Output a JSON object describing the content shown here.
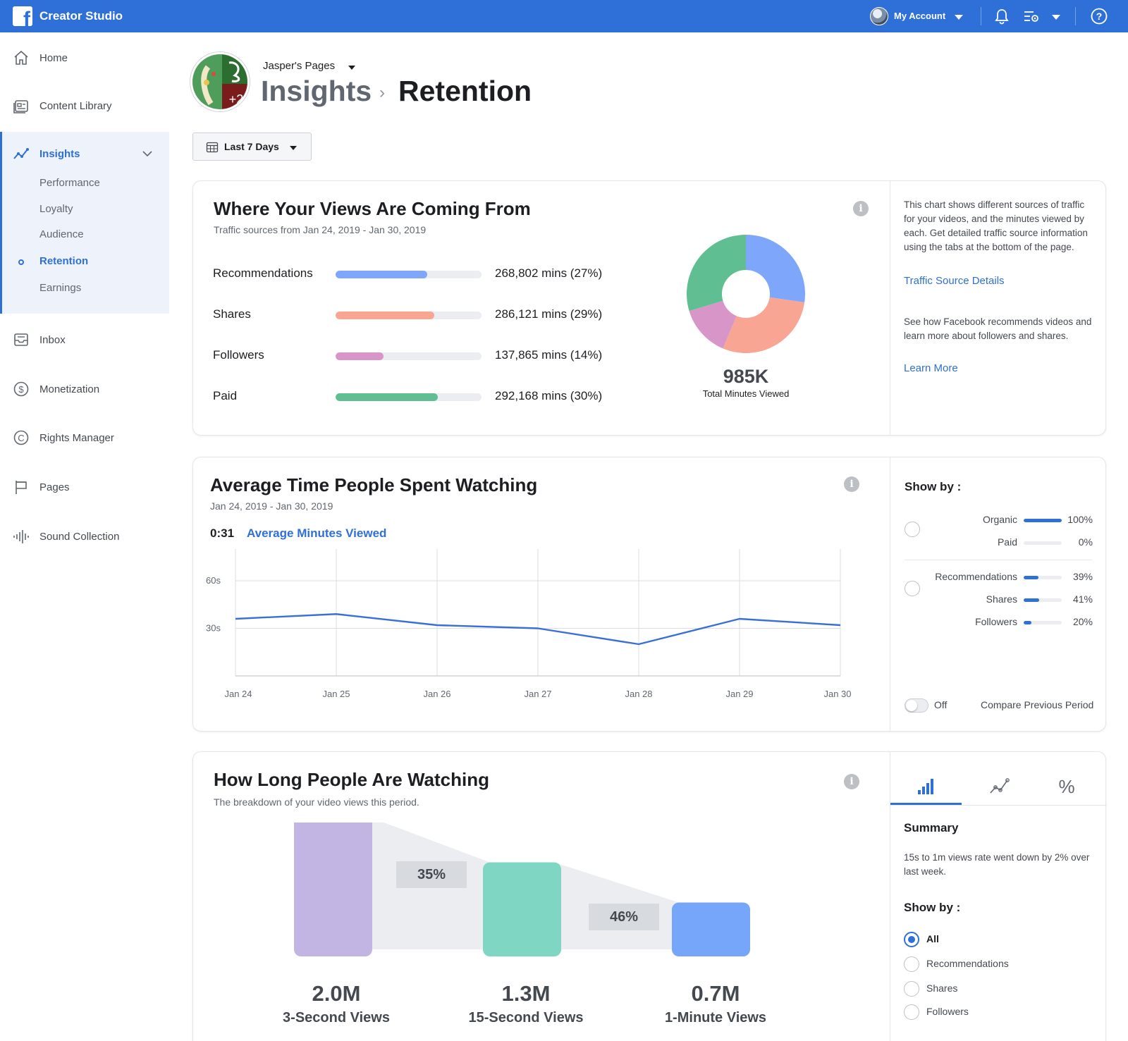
{
  "topbar": {
    "app_title": "Creator Studio",
    "account_label": "My Account",
    "icons": [
      "bell-icon",
      "settings-icon",
      "help-icon"
    ]
  },
  "sidebar": {
    "items": [
      {
        "label": "Home",
        "icon": "home-icon"
      },
      {
        "label": "Content Library",
        "icon": "content-library-icon"
      },
      {
        "label": "Insights",
        "icon": "insights-icon"
      },
      {
        "label": "Inbox",
        "icon": "inbox-icon"
      },
      {
        "label": "Monetization",
        "icon": "dollar-icon"
      },
      {
        "label": "Rights Manager",
        "icon": "copyright-icon"
      },
      {
        "label": "Pages",
        "icon": "flag-icon"
      },
      {
        "label": "Sound Collection",
        "icon": "sound-wave-icon"
      }
    ],
    "insights_sub": [
      "Performance",
      "Loyalty",
      "Audience",
      "Retention",
      "Earnings"
    ],
    "active_sub": "Retention"
  },
  "header": {
    "page_name": "Jasper's Pages",
    "crumb_parent": "Insights",
    "crumb_current": "Retention",
    "date_range_label": "Last 7 Days"
  },
  "views_card": {
    "title": "Where Your Views Are Coming From",
    "subtitle": "Traffic sources from Jan 24, 2019 - Jan 30, 2019",
    "sources": [
      {
        "label": "Recommendations",
        "value": "268,802 mins (27%)",
        "pct": 27,
        "color": "#7ea7fb"
      },
      {
        "label": "Shares",
        "value": "286,121 mins (29%)",
        "pct": 29,
        "color": "#f8a594"
      },
      {
        "label": "Followers",
        "value": "137,865 mins (14%)",
        "pct": 14,
        "color": "#d896c8"
      },
      {
        "label": "Paid",
        "value": "292,168 mins (30%)",
        "pct": 30,
        "color": "#5fbf93"
      }
    ],
    "total_value": "985K",
    "total_label": "Total Minutes Viewed",
    "side_text_1": "This chart shows different sources of traffic for your videos, and the minutes viewed by each. Get detailed traffic source information using the tabs at the bottom of the page.",
    "side_link_1": "Traffic Source Details",
    "side_text_2": "See how Facebook recommends videos and learn more about followers and shares.",
    "side_link_2": "Learn More"
  },
  "avg_card": {
    "title": "Average Time People Spent Watching",
    "subtitle": "Jan 24, 2019 - Jan 30, 2019",
    "avg_value": "0:31",
    "avg_label": "Average Minutes Viewed",
    "show_by_label": "Show by :",
    "group1": [
      {
        "label": "Organic",
        "pct": 100,
        "pct_label": "100%"
      },
      {
        "label": "Paid",
        "pct": 0,
        "pct_label": "0%"
      }
    ],
    "group2": [
      {
        "label": "Recommendations",
        "pct": 39,
        "pct_label": "39%"
      },
      {
        "label": "Shares",
        "pct": 41,
        "pct_label": "41%"
      },
      {
        "label": "Followers",
        "pct": 20,
        "pct_label": "20%"
      }
    ],
    "toggle_label": "Off",
    "compare_label": "Compare Previous Period"
  },
  "long_card": {
    "title": "How Long People Are Watching",
    "subtitle": "The breakdown of your video views this period.",
    "bars": [
      {
        "value_label": "2.0M",
        "label": "3-Second Views",
        "value": 2.0,
        "color": "#c3b5e3"
      },
      {
        "value_label": "1.3M",
        "label": "15-Second Views",
        "value": 1.3,
        "color": "#7fd6c3"
      },
      {
        "value_label": "0.7M",
        "label": "1-Minute Views",
        "value": 0.7,
        "color": "#75a6f9"
      }
    ],
    "drops": [
      "35%",
      "46%"
    ],
    "tab_icons": [
      "bar-chart-icon",
      "line-chart-icon",
      "percent-icon"
    ],
    "summary_title": "Summary",
    "summary_text": "15s to 1m views rate went down by 2% over last week.",
    "show_by_label": "Show by :",
    "radio_options": [
      "All",
      "Recommendations",
      "Shares",
      "Followers"
    ],
    "selected": "All"
  },
  "chart_data": [
    {
      "type": "pie",
      "categories": [
        "Recommendations",
        "Shares",
        "Followers",
        "Paid"
      ],
      "values": [
        268802,
        286121,
        137865,
        292168
      ],
      "colors": [
        "#7ea7fb",
        "#f8a594",
        "#d896c8",
        "#5fbf93"
      ]
    },
    {
      "type": "line",
      "x": [
        "Jan 24",
        "Jan 25",
        "Jan 26",
        "Jan 27",
        "Jan 28",
        "Jan 29",
        "Jan 30"
      ],
      "values": [
        36,
        39,
        32,
        30,
        20,
        36,
        32
      ],
      "yticks": [
        "30s",
        "60s"
      ],
      "ylim": [
        0,
        80
      ],
      "grid": true,
      "color": "#3a6fd8"
    }
  ]
}
